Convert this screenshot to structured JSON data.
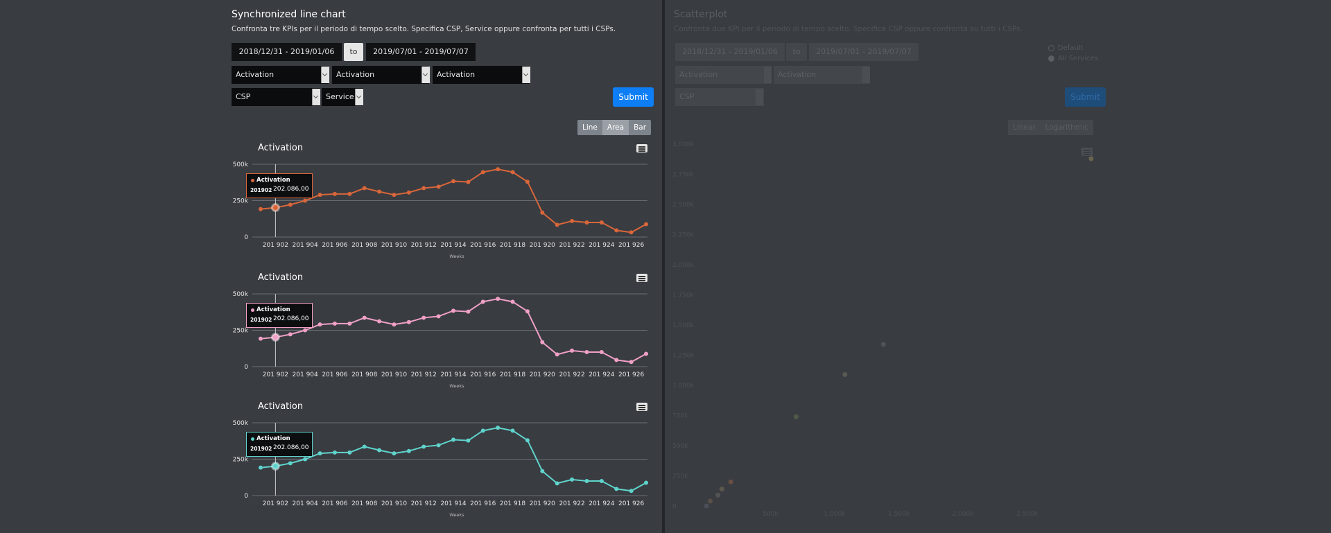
{
  "left": {
    "title": "Synchronized line chart",
    "description": "Confronta tre KPIs per il periodo di tempo scelto. Specifica CSP, Service oppure confronta per tutti i CSPs.",
    "date_from": "2018/12/31 - 2019/01/06",
    "to_label": "to",
    "date_to": "2019/07/01 - 2019/07/07",
    "kpi_1": "Activation",
    "kpi_2": "Activation",
    "kpi_3": "Activation",
    "csp": "CSP",
    "service": "Service",
    "submit": "Submit",
    "chart_types": [
      "Line",
      "Area",
      "Bar"
    ]
  },
  "right": {
    "title": "Scatterplot",
    "description": "Confronta due KPI per il periodo di tempo scelto. Specifica CSP oppure confronta su tutti i CSPs.",
    "date_from": "2018/12/31 - 2019/01/06",
    "to_label": "to",
    "date_to": "2019/07/01 - 2019/07/07",
    "kpi_1": "Activation",
    "kpi_2": "Activation",
    "csp": "CSP",
    "submit": "Submit",
    "legend": [
      "Default",
      "All Services"
    ],
    "scale_types": [
      "Linear",
      "Logarithmic"
    ]
  },
  "colors": {
    "chart_1": "#d9663a",
    "chart_2": "#f0a0c6",
    "chart_3": "#5fd4cc",
    "submit": "#0d7ef6"
  },
  "icons": {
    "menu": "hamburger-menu-icon"
  },
  "chart_data": [
    {
      "type": "line",
      "title": "Activation",
      "xlabel": "Weeks",
      "ylabel": "",
      "ylim": [
        0,
        500000
      ],
      "yticks": [
        "0",
        "250k",
        "500k"
      ],
      "categories": [
        "201901",
        "201902",
        "201903",
        "201904",
        "201905",
        "201906",
        "201907",
        "201908",
        "201909",
        "201910",
        "201911",
        "201912",
        "201913",
        "201914",
        "201915",
        "201916",
        "201917",
        "201918",
        "201919",
        "201920",
        "201921",
        "201922",
        "201923",
        "201924",
        "201925",
        "201926",
        "201927"
      ],
      "xtick_labels": [
        "201 902",
        "201 904",
        "201 906",
        "201 908",
        "201 910",
        "201 912",
        "201 914",
        "201 916",
        "201 918",
        "201 920",
        "201 922",
        "201 924",
        "201 926"
      ],
      "series": [
        {
          "name": "Activation",
          "values": [
            192000,
            202086,
            222000,
            250000,
            290000,
            296000,
            296000,
            336000,
            312000,
            290000,
            306000,
            336000,
            346000,
            384000,
            378000,
            446000,
            466000,
            446000,
            380000,
            168000,
            84000,
            110000,
            100000,
            100000,
            46000,
            32000,
            88000
          ]
        }
      ],
      "tooltip": {
        "series": "Activation",
        "x": "201902",
        "value": "202.086,00"
      }
    },
    {
      "type": "line",
      "title": "Activation",
      "xlabel": "Weeks",
      "ylabel": "",
      "ylim": [
        0,
        500000
      ],
      "yticks": [
        "0",
        "250k",
        "500k"
      ],
      "categories": [
        "201901",
        "201902",
        "201903",
        "201904",
        "201905",
        "201906",
        "201907",
        "201908",
        "201909",
        "201910",
        "201911",
        "201912",
        "201913",
        "201914",
        "201915",
        "201916",
        "201917",
        "201918",
        "201919",
        "201920",
        "201921",
        "201922",
        "201923",
        "201924",
        "201925",
        "201926",
        "201927"
      ],
      "xtick_labels": [
        "201 902",
        "201 904",
        "201 906",
        "201 908",
        "201 910",
        "201 912",
        "201 914",
        "201 916",
        "201 918",
        "201 920",
        "201 922",
        "201 924",
        "201 926"
      ],
      "series": [
        {
          "name": "Activation",
          "values": [
            192000,
            202086,
            222000,
            250000,
            290000,
            296000,
            296000,
            336000,
            312000,
            290000,
            306000,
            336000,
            346000,
            384000,
            378000,
            446000,
            466000,
            446000,
            380000,
            168000,
            84000,
            110000,
            100000,
            100000,
            46000,
            32000,
            88000
          ]
        }
      ],
      "tooltip": {
        "series": "Activation",
        "x": "201902",
        "value": "202.086,00"
      }
    },
    {
      "type": "line",
      "title": "Activation",
      "xlabel": "Weeks",
      "ylabel": "",
      "ylim": [
        0,
        500000
      ],
      "yticks": [
        "0",
        "250k",
        "500k"
      ],
      "categories": [
        "201901",
        "201902",
        "201903",
        "201904",
        "201905",
        "201906",
        "201907",
        "201908",
        "201909",
        "201910",
        "201911",
        "201912",
        "201913",
        "201914",
        "201915",
        "201916",
        "201917",
        "201918",
        "201919",
        "201920",
        "201921",
        "201922",
        "201923",
        "201924",
        "201925",
        "201926",
        "201927"
      ],
      "xtick_labels": [
        "201 902",
        "201 904",
        "201 906",
        "201 908",
        "201 910",
        "201 912",
        "201 914",
        "201 916",
        "201 918",
        "201 920",
        "201 922",
        "201 924",
        "201 926"
      ],
      "series": [
        {
          "name": "Activation",
          "values": [
            192000,
            202086,
            222000,
            250000,
            290000,
            296000,
            296000,
            336000,
            312000,
            290000,
            306000,
            336000,
            346000,
            384000,
            378000,
            446000,
            466000,
            446000,
            380000,
            168000,
            84000,
            110000,
            100000,
            100000,
            46000,
            32000,
            88000
          ]
        }
      ],
      "tooltip": {
        "series": "Activation",
        "x": "201902",
        "value": "202.086,00"
      }
    },
    {
      "type": "scatter",
      "title": "",
      "xlabel": "",
      "ylabel": "",
      "xticks": [
        "500k",
        "1.000k",
        "1.500k",
        "2.000k",
        "2.500k"
      ],
      "yticks": [
        "0",
        "250k",
        "500k",
        "750k",
        "1.000k",
        "1.250k",
        "1.500k",
        "1.750k",
        "2.000k",
        "2.250k",
        "2.500k",
        "2.750k",
        "3.000k"
      ],
      "points": [
        {
          "x": 0,
          "y": 0
        },
        {
          "x": 30000,
          "y": 40000
        },
        {
          "x": 90000,
          "y": 90000
        },
        {
          "x": 120000,
          "y": 140000
        },
        {
          "x": 190000,
          "y": 200000
        },
        {
          "x": 700000,
          "y": 740000
        },
        {
          "x": 1080000,
          "y": 1090000
        },
        {
          "x": 1380000,
          "y": 1340000
        },
        {
          "x": 3000000,
          "y": 2880000
        }
      ]
    }
  ]
}
